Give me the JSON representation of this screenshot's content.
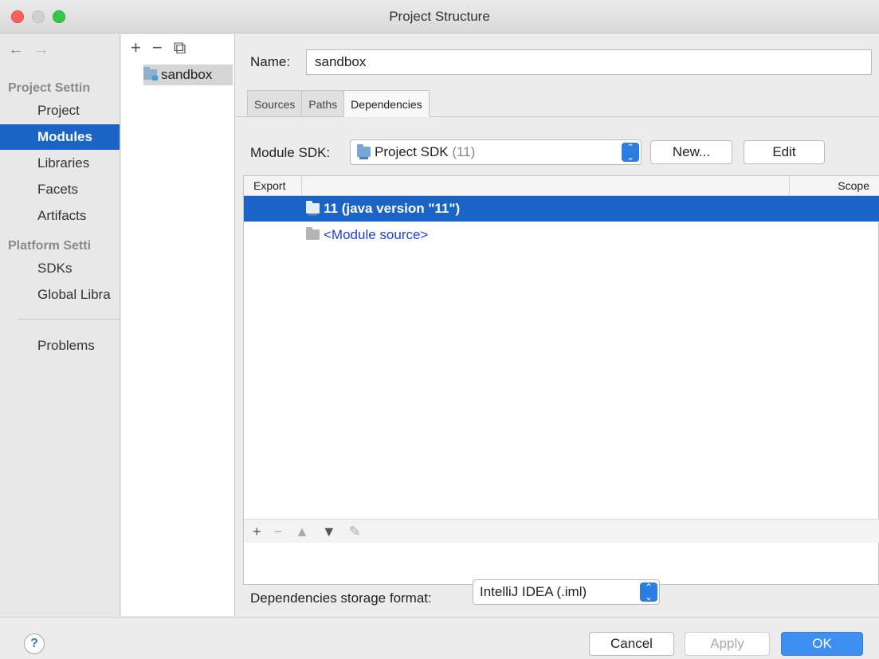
{
  "window": {
    "title": "Project Structure"
  },
  "sidebar": {
    "back_arrow": "←",
    "forward_arrow": "→",
    "sections": [
      {
        "header": "Project Settin",
        "items": [
          "Project",
          "Modules",
          "Libraries",
          "Facets",
          "Artifacts"
        ]
      },
      {
        "header": "Platform Setti",
        "items": [
          "SDKs",
          "Global Libra"
        ]
      }
    ],
    "problems": "Problems",
    "selected": "Modules"
  },
  "modules": {
    "toolbar": {
      "add": "+",
      "remove": "−",
      "copy": "⧉"
    },
    "items": [
      "sandbox"
    ]
  },
  "main": {
    "name_label": "Name:",
    "name_value": "sandbox",
    "tabs": [
      "Sources",
      "Paths",
      "Dependencies"
    ],
    "active_tab": "Dependencies",
    "module_sdk_label": "Module SDK:",
    "module_sdk_value": "Project SDK",
    "module_sdk_version": "(11)",
    "new_button": "New...",
    "edit_button": "Edit",
    "table": {
      "columns": [
        "Export",
        "Scope"
      ],
      "rows": [
        {
          "label": "11 (java version \"11\")",
          "selected": true
        },
        {
          "label": "<Module source>",
          "selected": false
        }
      ],
      "toolbar": {
        "add": "+",
        "remove": "−",
        "up": "▲",
        "down": "▼",
        "edit": "✎"
      }
    },
    "storage_format_label": "Dependencies storage format:",
    "storage_format_value": "IntelliJ IDEA (.iml)"
  },
  "footer": {
    "help": "?",
    "cancel": "Cancel",
    "apply": "Apply",
    "ok": "OK"
  },
  "colors": {
    "selection": "#1a63c7",
    "ok_button": "#3d8ff2",
    "module_source_text": "#1e3fe0"
  }
}
